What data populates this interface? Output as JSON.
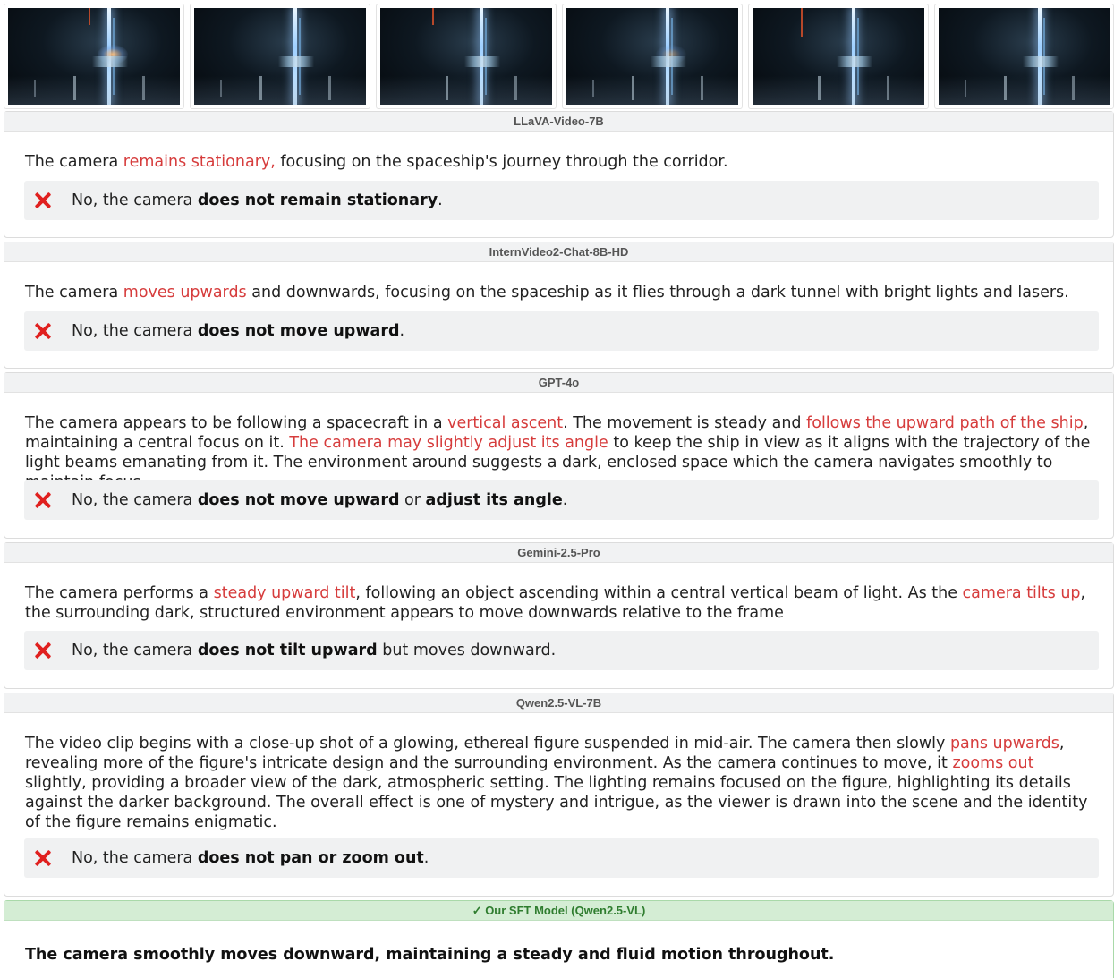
{
  "frames": [
    "frame-1",
    "frame-2",
    "frame-3",
    "frame-4",
    "frame-5",
    "frame-6"
  ],
  "colors": {
    "highlight": "#d63c3c",
    "error_icon": "#e0201f",
    "ours_header_bg": "#d4edd4",
    "ours_header_text": "#2f7d2f"
  },
  "cards": [
    {
      "model": "LLaVA-Video-7B",
      "response": [
        {
          "t": "The camera "
        },
        {
          "t": "remains stationary,",
          "hl": true
        },
        {
          "t": " focusing on the spaceship's journey through the corridor."
        }
      ],
      "verdict": [
        {
          "t": "No, the camera "
        },
        {
          "t": "does not remain stationary",
          "b": true
        },
        {
          "t": "."
        }
      ]
    },
    {
      "model": "InternVideo2-Chat-8B-HD",
      "response": [
        {
          "t": "The camera "
        },
        {
          "t": "moves upwards",
          "hl": true
        },
        {
          "t": " and downwards, focusing on the spaceship as it flies through a dark tunnel with bright lights and lasers."
        }
      ],
      "verdict": [
        {
          "t": "No, the camera "
        },
        {
          "t": "does not move upward",
          "b": true
        },
        {
          "t": "."
        }
      ]
    },
    {
      "model": "GPT-4o",
      "response": [
        {
          "t": "The camera appears to be following a spacecraft in a "
        },
        {
          "t": "vertical ascent",
          "hl": true
        },
        {
          "t": ". The movement is steady and "
        },
        {
          "t": "follows the upward path of the ship",
          "hl": true
        },
        {
          "t": ", maintaining a central focus on it. "
        },
        {
          "t": "The camera may slightly adjust its angle",
          "hl": true
        },
        {
          "t": " to keep the ship in view as it aligns with the trajectory of the light beams emanating from it. The environment around suggests a dark, enclosed space which the camera navigates smoothly to maintain focus."
        }
      ],
      "verdict": [
        {
          "t": "No, the camera "
        },
        {
          "t": "does not move upward",
          "b": true
        },
        {
          "t": " or "
        },
        {
          "t": "adjust its angle",
          "b": true
        },
        {
          "t": "."
        }
      ]
    },
    {
      "model": "Gemini-2.5-Pro",
      "response": [
        {
          "t": "The camera performs a "
        },
        {
          "t": "steady upward tilt",
          "hl": true
        },
        {
          "t": ", following an object ascending within a central vertical beam of light. As the "
        },
        {
          "t": "camera tilts up",
          "hl": true
        },
        {
          "t": ", the surrounding dark, structured environment appears to move downwards relative to the frame"
        }
      ],
      "verdict": [
        {
          "t": "No, the camera "
        },
        {
          "t": "does not tilt upward",
          "b": true
        },
        {
          "t": " but moves downward."
        }
      ]
    },
    {
      "model": "Qwen2.5-VL-7B",
      "response": [
        {
          "t": "The video clip begins with a close-up shot of a glowing, ethereal figure suspended in mid-air. The camera then slowly "
        },
        {
          "t": "pans upwards",
          "hl": true
        },
        {
          "t": ", revealing more of the figure's intricate design and the surrounding environment. As the camera continues to move, it "
        },
        {
          "t": "zooms out",
          "hl": true
        },
        {
          "t": " slightly, providing a broader view of the dark, atmospheric setting. The lighting remains focused on the figure, highlighting its details against the darker background. The overall effect is one of mystery and intrigue, as the viewer is drawn into the scene and the identity of the figure remains enigmatic."
        }
      ],
      "verdict": [
        {
          "t": "No, the camera "
        },
        {
          "t": "does not pan or zoom out",
          "b": true
        },
        {
          "t": "."
        }
      ]
    }
  ],
  "ours": {
    "model": "✓ Our SFT Model (Qwen2.5-VL)",
    "response": "The camera smoothly moves downward, maintaining a steady and fluid motion throughout."
  }
}
